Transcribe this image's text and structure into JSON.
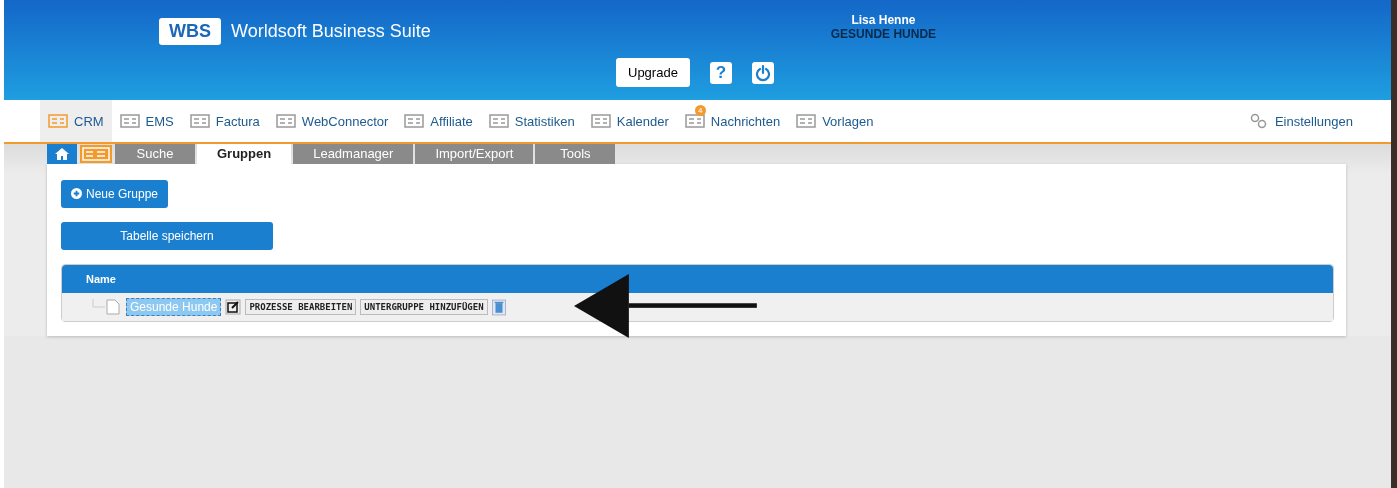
{
  "header": {
    "logo": "WBS",
    "title": "Worldsoft Business Suite",
    "user": "Lisa Henne",
    "company": "GESUNDE HUNDE",
    "upgrade": "Upgrade",
    "help": "?"
  },
  "nav": [
    {
      "label": "CRM",
      "selected": true
    },
    {
      "label": "EMS",
      "selected": false
    },
    {
      "label": "Factura",
      "selected": false
    },
    {
      "label": "WebConnector",
      "selected": false
    },
    {
      "label": "Affiliate",
      "selected": false
    },
    {
      "label": "Statistiken",
      "selected": false
    },
    {
      "label": "Kalender",
      "selected": false
    },
    {
      "label": "Nachrichten",
      "selected": false,
      "badge": "4"
    },
    {
      "label": "Vorlagen",
      "selected": false
    }
  ],
  "settings": "Einstellungen",
  "tabs": [
    {
      "label": "Suche",
      "selected": false
    },
    {
      "label": "Gruppen",
      "selected": true
    },
    {
      "label": "Leadmanager",
      "selected": false
    },
    {
      "label": "Import/Export",
      "selected": false
    },
    {
      "label": "Tools",
      "selected": false
    }
  ],
  "new_group": "Neue Gruppe",
  "save_table": "Tabelle speichern",
  "table": {
    "columns": [
      "Name"
    ],
    "rows": [
      {
        "name": "Gesunde Hunde",
        "selected": true,
        "actions": [
          "PROZESSE BEARBEITEN",
          "UNTERGRUPPE HINZUFÜGEN"
        ]
      }
    ]
  }
}
